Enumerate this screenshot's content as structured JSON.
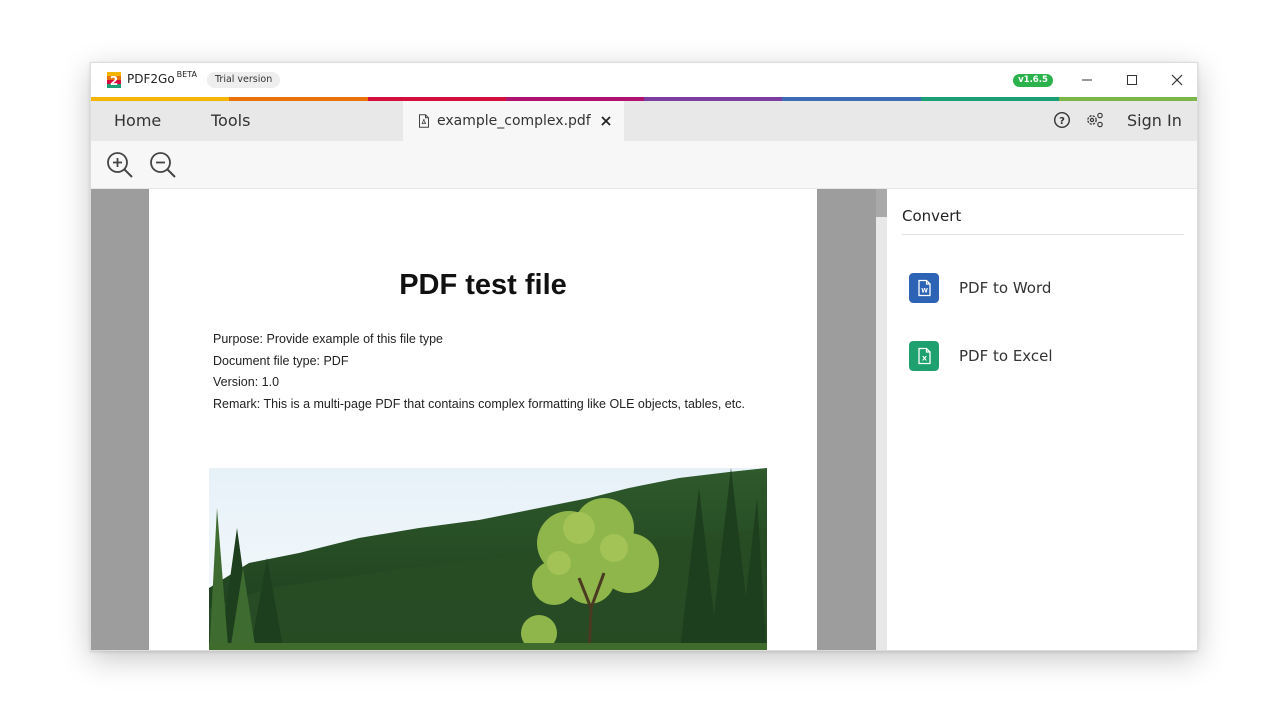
{
  "app": {
    "name": "PDF2Go",
    "beta_label": "BETA",
    "trial_label": "Trial version",
    "version": "v1.6.5"
  },
  "window_controls": [
    "minimize-icon",
    "maximize-icon",
    "close-icon"
  ],
  "accent_colors": [
    "#f4b400",
    "#e8710a",
    "#d50f3d",
    "#b0136f",
    "#7b3ea0",
    "#3d6cb4",
    "#1a9e73",
    "#7ab648"
  ],
  "nav": {
    "home_label": "Home",
    "tools_label": "Tools"
  },
  "document_tab": {
    "filename": "example_complex.pdf",
    "icon": "pdf-file-icon"
  },
  "header_actions": {
    "help_icon": "help-icon",
    "settings_icon": "settings-icon",
    "sign_in_label": "Sign In"
  },
  "toolbar": {
    "zoom_in_icon": "zoom-in-icon",
    "zoom_out_icon": "zoom-out-icon"
  },
  "document": {
    "title": "PDF test file",
    "lines": [
      "Purpose: Provide example of this file type",
      "Document file type: PDF",
      "Version: 1.0",
      "Remark: This is a multi-page PDF that contains complex formatting like OLE objects, tables, etc."
    ],
    "image_subject": "forest landscape photo"
  },
  "sidebar": {
    "title": "Convert",
    "items": [
      {
        "label": "PDF to Word",
        "icon": "word-document-icon",
        "color": "#2d63b5"
      },
      {
        "label": "PDF to Excel",
        "icon": "excel-document-icon",
        "color": "#1ea06f"
      }
    ]
  }
}
